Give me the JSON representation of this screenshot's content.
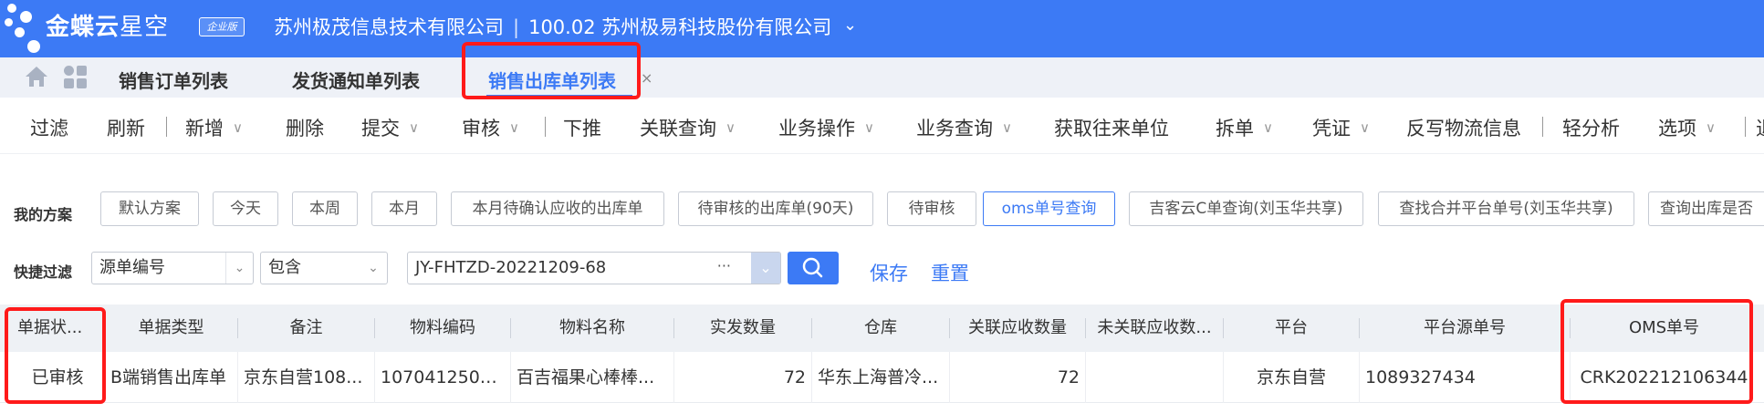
{
  "header": {
    "brand_bold": "金蝶云",
    "brand_light": "星空",
    "edition": "企业版",
    "org_left": "苏州极茂信息技术有限公司",
    "org_separator": "|",
    "org_right": "100.02 苏州极易科技股份有限公司",
    "org_chevron": "⌄"
  },
  "tabs": [
    {
      "label": "销售订单列表",
      "active": false
    },
    {
      "label": "发货通知单列表",
      "active": false
    },
    {
      "label": "销售出库单列表",
      "active": true
    }
  ],
  "tab_close": "×",
  "toolbar": {
    "items": [
      {
        "label": "过滤",
        "dropdown": false
      },
      {
        "label": "刷新",
        "dropdown": false
      },
      {
        "label": "新增",
        "dropdown": true
      },
      {
        "label": "删除",
        "dropdown": false
      },
      {
        "label": "提交",
        "dropdown": true
      },
      {
        "label": "审核",
        "dropdown": true
      },
      {
        "label": "下推",
        "dropdown": false
      },
      {
        "label": "关联查询",
        "dropdown": true
      },
      {
        "label": "业务操作",
        "dropdown": true
      },
      {
        "label": "业务查询",
        "dropdown": true
      },
      {
        "label": "获取往来单位",
        "dropdown": false
      },
      {
        "label": "拆单",
        "dropdown": true
      },
      {
        "label": "凭证",
        "dropdown": true
      },
      {
        "label": "反写物流信息",
        "dropdown": false
      },
      {
        "label": "轻分析",
        "dropdown": false
      },
      {
        "label": "选项",
        "dropdown": true
      },
      {
        "label": "退",
        "dropdown": false
      }
    ],
    "separator": "|",
    "chevron": "∨"
  },
  "schemes": {
    "label": "我的方案",
    "items": [
      {
        "label": "默认方案",
        "active": false
      },
      {
        "label": "今天",
        "active": false
      },
      {
        "label": "本周",
        "active": false
      },
      {
        "label": "本月",
        "active": false
      },
      {
        "label": "本月待确认应收的出库单",
        "active": false
      },
      {
        "label": "待审核的出库单(90天)",
        "active": false
      },
      {
        "label": "待审核",
        "active": false
      },
      {
        "label": "oms单号查询",
        "active": true
      },
      {
        "label": "吉客云C单查询(刘玉华共享)",
        "active": false
      },
      {
        "label": "查找合并平台单号(刘玉华共享)",
        "active": false
      },
      {
        "label": "查询出库是否",
        "active": false
      }
    ]
  },
  "quick_filter": {
    "label": "快捷过滤",
    "field": "源单编号",
    "operator": "包含",
    "value": "JY-FHTZD-20221209-68",
    "ellipsis": "···",
    "save_label": "保存",
    "reset_label": "重置"
  },
  "table": {
    "columns": [
      "单据状...",
      "单据类型",
      "备注",
      "物料编码",
      "物料名称",
      "实发数量",
      "仓库",
      "关联应收数量",
      "未关联应收数...",
      "平台",
      "平台源单号",
      "OMS单号"
    ],
    "rows": [
      [
        "已审核",
        "B端销售出库单",
        "京东自营108...",
        "1070412500...",
        "百吉福果心棒棒...",
        "72",
        "华东上海普冷...",
        "72",
        "",
        "京东自营",
        "1089327434",
        "CRK202212106344"
      ]
    ]
  },
  "colors": {
    "header_bg": "#3c7af5",
    "accent": "#3c7af5",
    "annotation_red": "#ff1a1a"
  }
}
